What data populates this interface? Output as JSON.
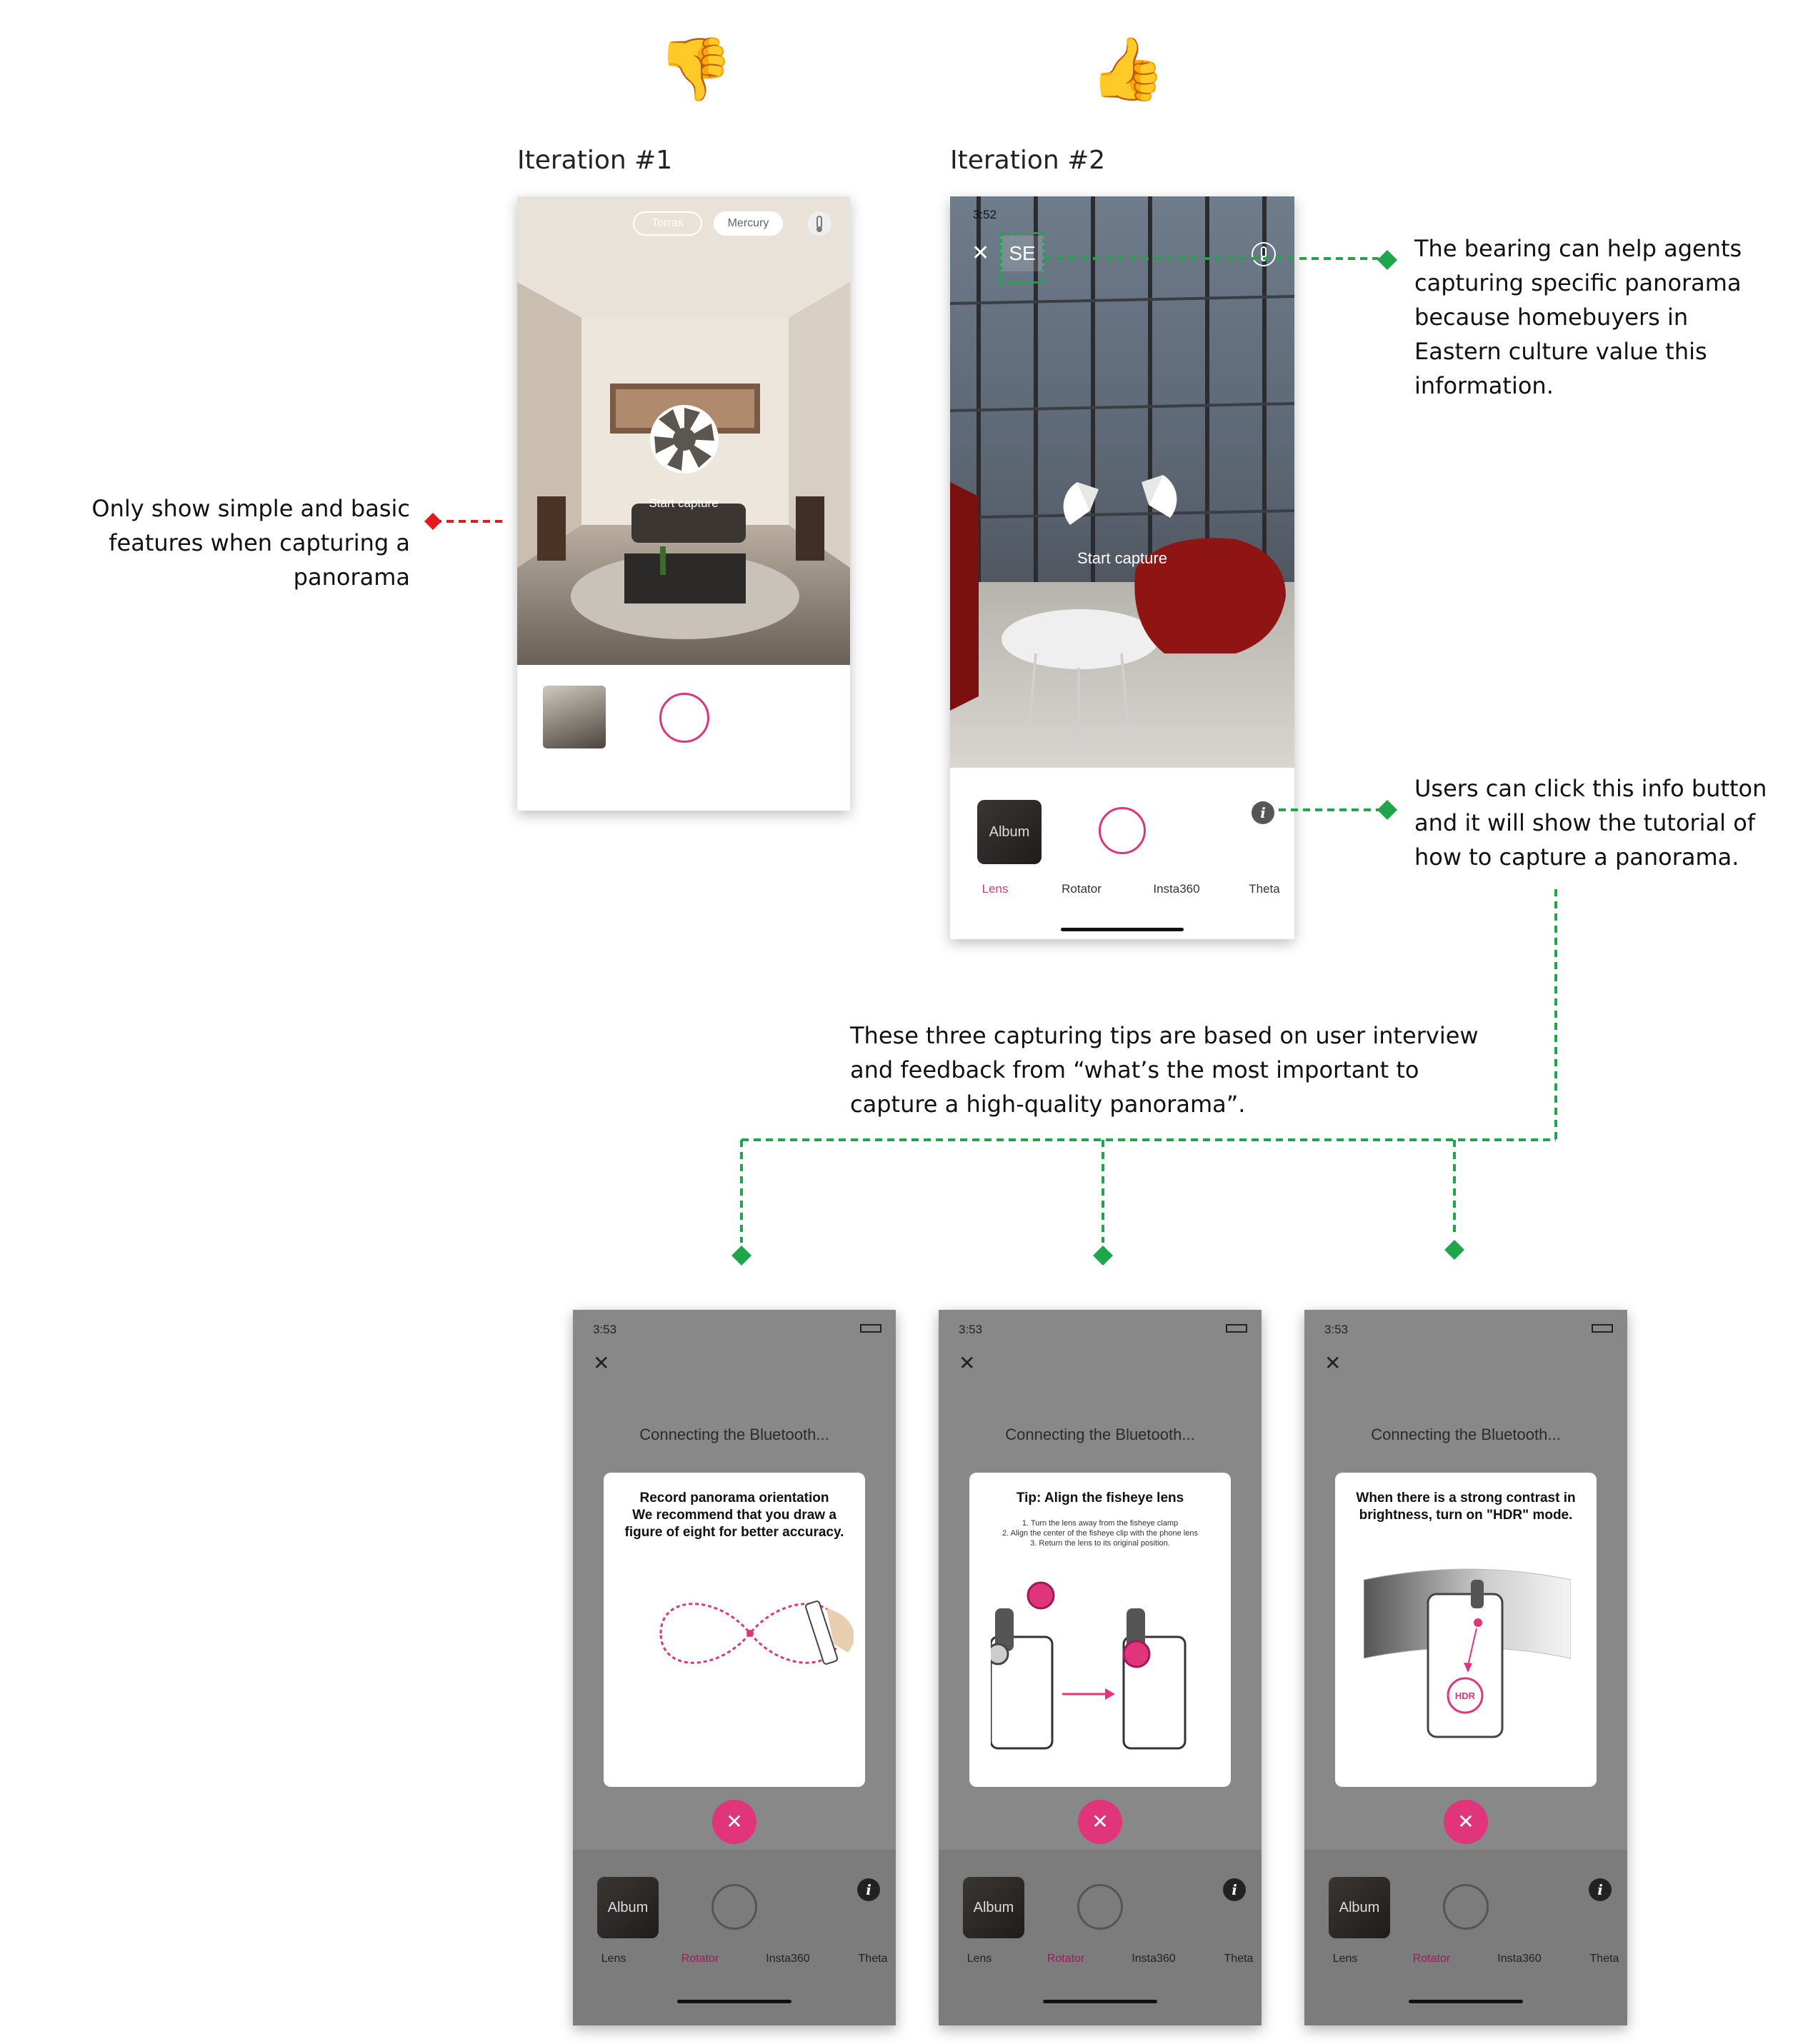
{
  "emojis": {
    "thumbs_down": "👎",
    "thumbs_up": "👍"
  },
  "iteration1": {
    "title": "Iteration #1",
    "pills": [
      "Torras",
      "Mercury"
    ],
    "start_capture": "Start capture"
  },
  "iteration2": {
    "title": "Iteration #2",
    "status_time": "3:52",
    "bearing": "SE",
    "start_capture": "Start capture",
    "album_label": "Album",
    "tabs": [
      "Lens",
      "Rotator",
      "Insta360",
      "Theta"
    ],
    "active_tab": "Lens"
  },
  "notes": {
    "left": [
      "Only show simple and basic",
      "features when capturing a",
      "panorama"
    ],
    "bearing": [
      "The bearing can help agents",
      "capturing specific panorama",
      "because homebuyers in",
      "Eastern culture value this",
      "information."
    ],
    "info": [
      "Users can click this info button",
      "and it will show the tutorial of",
      "how to capture a panorama."
    ],
    "tips": [
      "These three capturing tips are based on user interview",
      "and feedback from “what’s the most important to",
      "capture a high-quality panorama”."
    ]
  },
  "tip_screens": [
    {
      "time": "3:53",
      "connecting": "Connecting the Bluetooth...",
      "title_lines": [
        "Record panorama orientation",
        "We recommend that you draw a",
        "figure of eight for better accuracy."
      ],
      "small_lines": [],
      "album_label": "Album",
      "tabs": [
        "Lens",
        "Rotator",
        "Insta360",
        "Theta"
      ]
    },
    {
      "time": "3:53",
      "connecting": "Connecting the Bluetooth...",
      "title_lines": [
        "Tip: Align the fisheye lens"
      ],
      "small_lines": [
        "1. Turn the lens away from the fisheye clamp",
        "2. Align the center of the fisheye clip with the phone lens",
        "3. Return the lens to its original position."
      ],
      "album_label": "Album",
      "tabs": [
        "Lens",
        "Rotator",
        "Insta360",
        "Theta"
      ]
    },
    {
      "time": "3:53",
      "connecting": "Connecting the Bluetooth...",
      "title_lines": [
        "When there is a strong contrast in",
        "brightness, turn on \"HDR\" mode."
      ],
      "small_lines": [],
      "hdr_label": "HDR",
      "album_label": "Album",
      "tabs": [
        "Lens",
        "Rotator",
        "Insta360",
        "Theta"
      ]
    }
  ],
  "colors": {
    "accent": "#e0357a",
    "annotation_green": "#1fa64a",
    "annotation_red": "#e41a1a",
    "overlay_gray": "#888888"
  }
}
